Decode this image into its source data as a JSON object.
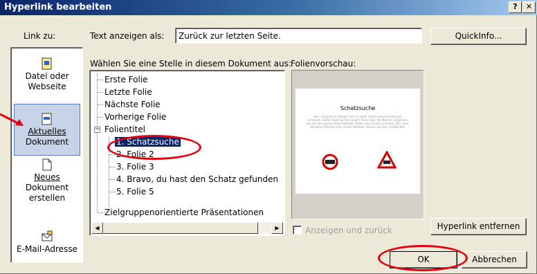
{
  "title": "Hyperlink bearbeiten",
  "title_buttons": [
    "?",
    "✕"
  ],
  "link_to_label": "Link zu:",
  "display_text_label": "Text anzeigen als:",
  "display_text_value": "Zurück zur letzten Seite.",
  "quickinfo_button": "QuickInfo...",
  "place_label": "Wählen Sie eine Stelle in diesem Dokument aus:",
  "preview_label": "Folienvorschau:",
  "linkbar": {
    "items": [
      {
        "line1": "Datei oder",
        "line2": "Webseite",
        "icon": "web-page-icon"
      },
      {
        "line1": "Aktuelles",
        "line2": "Dokument",
        "icon": "current-document-icon",
        "selected": true
      },
      {
        "line1": "Neues",
        "line2": "Dokument",
        "line3": "erstellen",
        "icon": "new-document-icon"
      },
      {
        "line1": "E-Mail-Adresse",
        "icon": "email-icon"
      }
    ]
  },
  "tree": {
    "items": [
      {
        "label": "Erste Folie"
      },
      {
        "label": "Letzte Folie"
      },
      {
        "label": "Nächste Folie"
      },
      {
        "label": "Vorherige Folie"
      },
      {
        "label": "Folientitel",
        "expander": "−"
      },
      {
        "label": "1. Schatzsuche",
        "selected": true
      },
      {
        "label": "2. Folie 2"
      },
      {
        "label": "3. Folie 3"
      },
      {
        "label": "4. Bravo, du hast den Schatz gefunden"
      },
      {
        "label": "5. Folie 5"
      },
      {
        "label": "Zielgruppenorientierte Präsentationen"
      }
    ]
  },
  "slide_preview": {
    "title": "Schatzsuche",
    "body": "Hier, vergrub der Räuber hier in vielen Zahlen einen Schatz gut versteckt. Leider Feuer auf der langen Reise über die Meeren vergessen, wo sich der genau Stelle befindet. Helfen den Schatz zu finden. Der neue Hinweise befinden sich an den Behälter. Klicken auf das richtige Bild."
  },
  "show_and_return_label": "Anzeigen und zurück",
  "remove_link_button": "Hyperlink entfernen",
  "ok_button": "OK",
  "cancel_button": "Abbrechen",
  "colors": {
    "annotation_red": "#e00010",
    "selection_blue": "#0a246a"
  }
}
